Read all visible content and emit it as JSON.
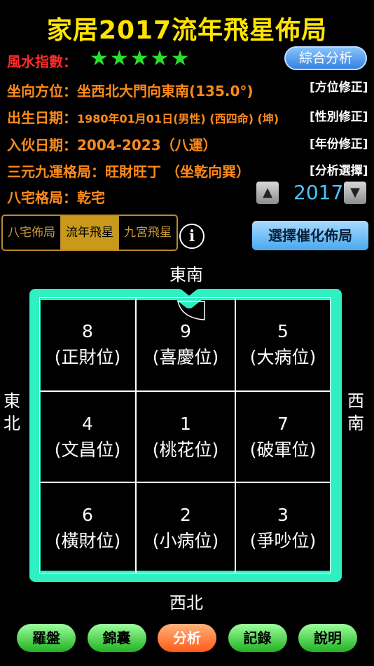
{
  "title": "家居2017流年飛星佈局",
  "rating": {
    "label": "風水指數：",
    "stars": "★★★★★",
    "star_count": 5
  },
  "analysis_button": "綜合分析",
  "rows": [
    {
      "label": "坐向方位：",
      "value": "坐西北大門向東南(135.0°)",
      "action": "[方位修正]"
    },
    {
      "label": "出生日期：",
      "value": "1980年01月01日(男性) (西四命) (坤)",
      "action": "[性別修正]"
    },
    {
      "label": "入伙日期：",
      "value": "2004-2023（八運）",
      "action": "[年份修正]"
    },
    {
      "label": "三元九運格局：",
      "value": "旺財旺丁 （坐乾向巽）",
      "action": "[分析選擇]"
    },
    {
      "label": "八宅格局：",
      "value": "乾宅"
    }
  ],
  "year": "2017",
  "tabs": [
    {
      "label": "八宅佈局",
      "active": false
    },
    {
      "label": "流年飛星",
      "active": true
    },
    {
      "label": "九宮飛星",
      "active": false
    }
  ],
  "info_symbol": "i",
  "choose_button": "選擇催化佈局",
  "directions": {
    "top": "東南",
    "bottom": "西北",
    "left": [
      "東",
      "北"
    ],
    "right": [
      "西",
      "南"
    ]
  },
  "grid": [
    {
      "num": "8",
      "label": "(正財位)"
    },
    {
      "num": "9",
      "label": "(喜慶位)"
    },
    {
      "num": "5",
      "label": "(大病位)"
    },
    {
      "num": "4",
      "label": "(文昌位)"
    },
    {
      "num": "1",
      "label": "(桃花位)"
    },
    {
      "num": "7",
      "label": "(破軍位)"
    },
    {
      "num": "6",
      "label": "(橫財位)"
    },
    {
      "num": "2",
      "label": "(小病位)"
    },
    {
      "num": "3",
      "label": "(爭吵位)"
    }
  ],
  "bottom_nav": [
    {
      "label": "羅盤",
      "active": false
    },
    {
      "label": "錦囊",
      "active": false
    },
    {
      "label": "分析",
      "active": true
    },
    {
      "label": "記錄",
      "active": false
    },
    {
      "label": "說明",
      "active": false
    }
  ],
  "colors": {
    "title": "#ffe400",
    "house_wall": "#2ff0c0",
    "year": "#49c6ff",
    "stars": "#29e02a"
  }
}
